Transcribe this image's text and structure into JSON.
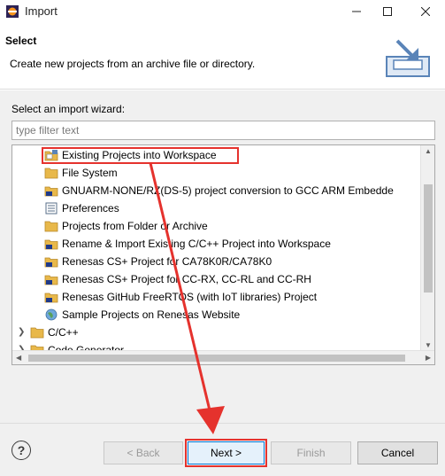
{
  "window": {
    "title": "Import"
  },
  "header": {
    "title": "Select",
    "description": "Create new projects from an archive file or directory."
  },
  "wizard": {
    "label": "Select an import wizard:",
    "filter_placeholder": "type filter text",
    "items": [
      {
        "label": "Existing Projects into Workspace",
        "icon": "existing-projects-icon"
      },
      {
        "label": "File System",
        "icon": "folder-icon"
      },
      {
        "label": "GNUARM-NONE/RZ(DS-5)  project conversion to GCC ARM Embedde",
        "icon": "renesas-project-icon"
      },
      {
        "label": "Preferences",
        "icon": "preferences-icon"
      },
      {
        "label": "Projects from Folder or Archive",
        "icon": "folder-icon"
      },
      {
        "label": "Rename & Import Existing C/C++ Project into Workspace",
        "icon": "renesas-project-icon"
      },
      {
        "label": "Renesas CS+ Project for CA78K0R/CA78K0",
        "icon": "renesas-project-icon"
      },
      {
        "label": "Renesas CS+ Project for CC-RX, CC-RL and CC-RH",
        "icon": "renesas-project-icon"
      },
      {
        "label": "Renesas GitHub FreeRTOS (with IoT libraries) Project",
        "icon": "renesas-project-icon"
      },
      {
        "label": "Sample Projects on Renesas Website",
        "icon": "globe-icon"
      }
    ],
    "categories": [
      {
        "label": "C/C++"
      },
      {
        "label": "Code Generator"
      }
    ]
  },
  "buttons": {
    "help": "?",
    "back": "< Back",
    "next": "Next >",
    "finish": "Finish",
    "cancel": "Cancel"
  },
  "colors": {
    "annotation": "#e5322d",
    "folder": "#e8b84a",
    "accent": "#0078d7"
  }
}
